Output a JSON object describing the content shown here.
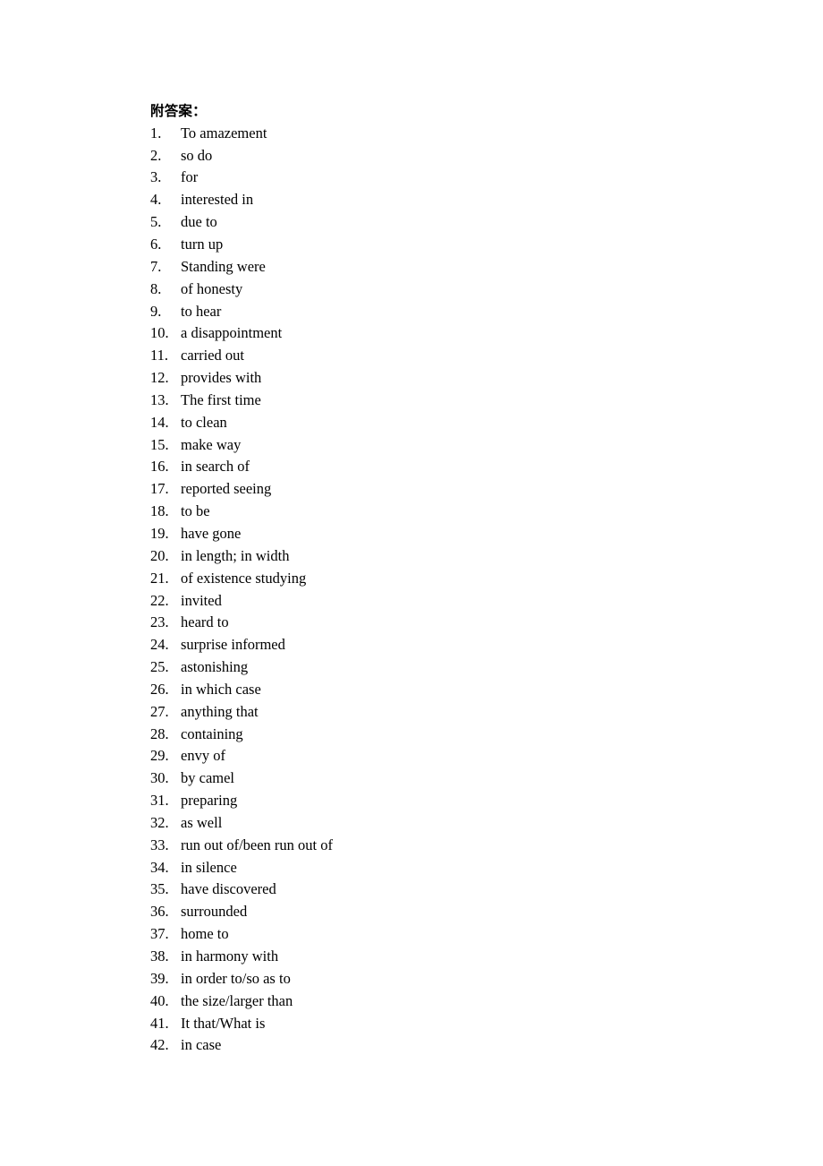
{
  "document": {
    "heading": "附答案：",
    "background_color": "#ffffff",
    "text_color": "#000000",
    "total_items": 42
  },
  "answers": [
    {
      "number": "1.",
      "text": "To amazement"
    },
    {
      "number": "2.",
      "text": "so do"
    },
    {
      "number": "3.",
      "text": "for"
    },
    {
      "number": "4.",
      "text": "interested in"
    },
    {
      "number": "5.",
      "text": "due to"
    },
    {
      "number": "6.",
      "text": "turn up"
    },
    {
      "number": "7.",
      "text": "Standing were"
    },
    {
      "number": "8.",
      "text": "of honesty"
    },
    {
      "number": "9.",
      "text": "to hear"
    },
    {
      "number": "10.",
      "text": "a disappointment"
    },
    {
      "number": "11.",
      "text": "carried out"
    },
    {
      "number": "12.",
      "text": "provides with"
    },
    {
      "number": "13.",
      "text": "The first time"
    },
    {
      "number": "14.",
      "text": "to clean"
    },
    {
      "number": "15.",
      "text": "make way"
    },
    {
      "number": "16.",
      "text": "in search of"
    },
    {
      "number": "17.",
      "text": "reported seeing"
    },
    {
      "number": "18.",
      "text": "to be"
    },
    {
      "number": "19.",
      "text": "have gone"
    },
    {
      "number": "20.",
      "text": "in length; in width"
    },
    {
      "number": "21.",
      "text": "of existence studying"
    },
    {
      "number": "22.",
      "text": "invited"
    },
    {
      "number": "23.",
      "text": "heard to"
    },
    {
      "number": "24.",
      "text": "surprise informed"
    },
    {
      "number": "25.",
      "text": "astonishing"
    },
    {
      "number": "26.",
      "text": "in which case"
    },
    {
      "number": "27.",
      "text": "anything that"
    },
    {
      "number": "28.",
      "text": "containing"
    },
    {
      "number": "29.",
      "text": "envy of"
    },
    {
      "number": "30.",
      "text": "by camel"
    },
    {
      "number": "31.",
      "text": "preparing"
    },
    {
      "number": "32.",
      "text": "as well"
    },
    {
      "number": "33.",
      "text": "run out of/been run out of"
    },
    {
      "number": "34.",
      "text": "in silence"
    },
    {
      "number": "35.",
      "text": "have discovered"
    },
    {
      "number": "36.",
      "text": "surrounded"
    },
    {
      "number": "37.",
      "text": "home to"
    },
    {
      "number": "38.",
      "text": "in harmony with"
    },
    {
      "number": "39.",
      "text": "in order to/so as to"
    },
    {
      "number": "40.",
      "text": "the size/larger than"
    },
    {
      "number": "41.",
      "text": "It that/What is"
    },
    {
      "number": "42.",
      "text": "in case"
    }
  ]
}
